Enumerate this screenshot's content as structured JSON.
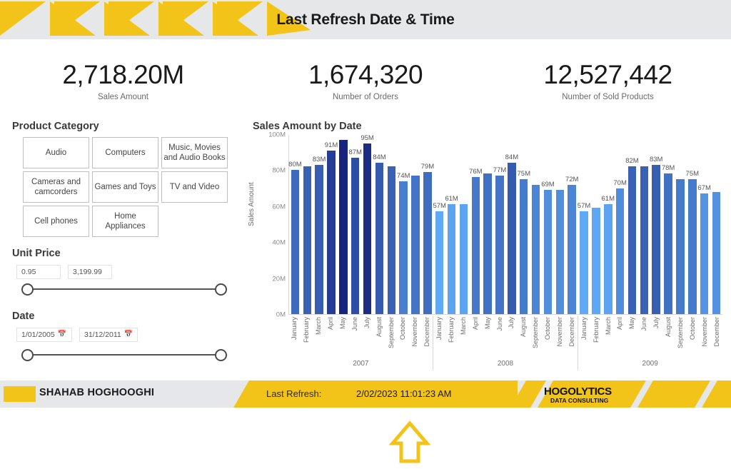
{
  "header": {
    "title": "Last Refresh Date & Time"
  },
  "kpis": [
    {
      "value": "2,718.20M",
      "label": "Sales Amount"
    },
    {
      "value": "1,674,320",
      "label": "Number of Orders"
    },
    {
      "value": "12,527,442",
      "label": "Number of Sold Products"
    }
  ],
  "product_category": {
    "title": "Product Category",
    "items": [
      "Audio",
      "Computers",
      "Music, Movies and Audio Books",
      "Cameras and camcorders",
      "Games and Toys",
      "TV and Video",
      "Cell phones",
      "Home Appliances"
    ]
  },
  "unit_price": {
    "title": "Unit Price",
    "min": "0.95",
    "max": "3,199.99"
  },
  "date_slicer": {
    "title": "Date",
    "start": "1/01/2005",
    "end": "31/12/2011",
    "calendar_icon": "calendar-icon"
  },
  "footer": {
    "author": "SHAHAB HOGHOOGHI",
    "refresh_label": "Last Refresh:",
    "refresh_value": "2/02/2023 11:01:23 AM",
    "logo_main": "HOGOLYTICS",
    "logo_sub": "DATA CONSULTING",
    "arrow_icon": "up-arrow-icon"
  },
  "colors": {
    "accent_yellow": "#f2c318",
    "header_gray": "#e6e7e8",
    "bar_dark": "#17237c",
    "bar_light": "#5fa9f5"
  },
  "chart_data": {
    "type": "bar",
    "title": "Sales Amount by Date",
    "xlabel": "",
    "ylabel": "Sales Amount",
    "ylim": [
      0,
      100
    ],
    "yticks": [
      "0M",
      "20M",
      "40M",
      "60M",
      "80M",
      "100M"
    ],
    "grid": false,
    "legend": "none",
    "value_suffix": "M",
    "groups": [
      "2007",
      "2008",
      "2009"
    ],
    "categories": [
      "January",
      "February",
      "March",
      "April",
      "May",
      "June",
      "July",
      "August",
      "September",
      "October",
      "November",
      "December"
    ],
    "series": [
      {
        "name": "2007",
        "values": [
          80,
          82,
          83,
          91,
          97,
          87,
          95,
          84,
          82,
          74,
          77,
          79
        ],
        "labels": [
          "80M",
          "",
          "83M",
          "91M",
          "",
          "87M",
          "95M",
          "84M",
          "",
          "74M",
          "",
          "79M"
        ]
      },
      {
        "name": "2008",
        "values": [
          57,
          61,
          61,
          76,
          78,
          77,
          84,
          75,
          72,
          69,
          69,
          72
        ],
        "labels": [
          "57M",
          "61M",
          "",
          "76M",
          "",
          "77M",
          "84M",
          "75M",
          "",
          "69M",
          "",
          "72M"
        ]
      },
      {
        "name": "2009",
        "values": [
          57,
          59,
          61,
          70,
          82,
          82,
          83,
          78,
          75,
          75,
          67,
          68
        ],
        "labels": [
          "57M",
          "",
          "61M",
          "70M",
          "82M",
          "",
          "83M",
          "78M",
          "",
          "75M",
          "67M",
          ""
        ]
      }
    ]
  }
}
